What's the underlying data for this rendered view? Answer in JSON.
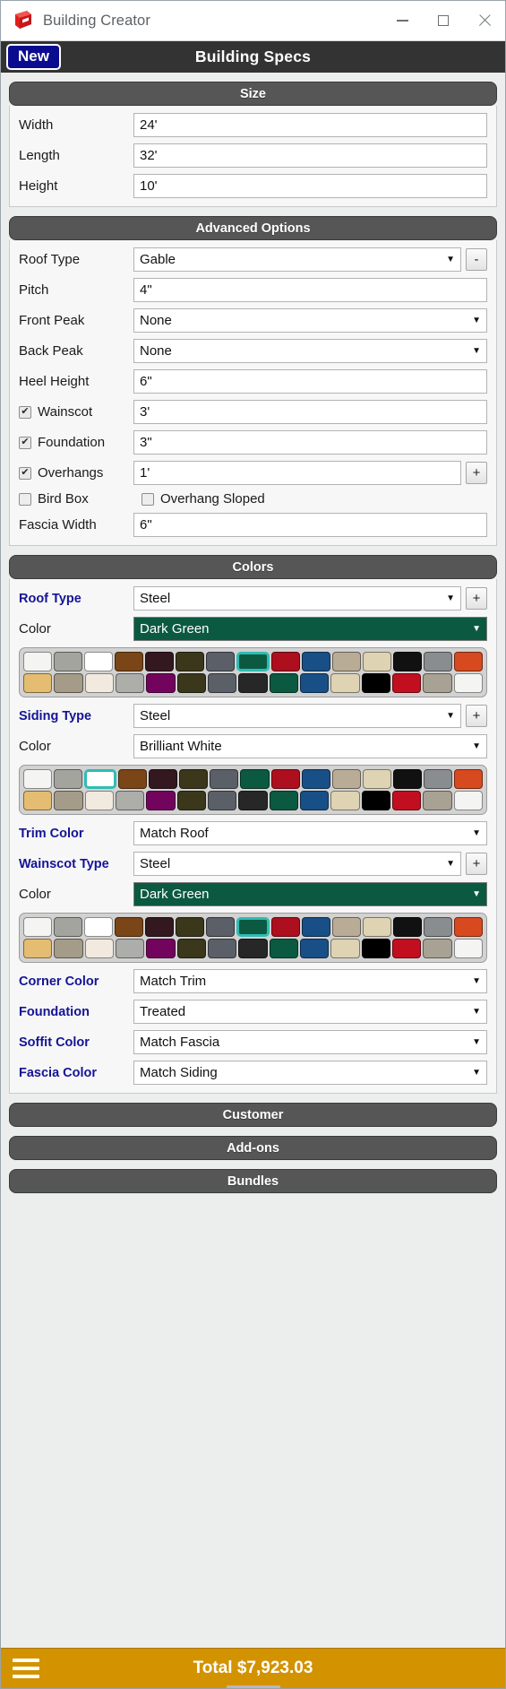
{
  "window": {
    "title": "Building Creator",
    "logo_icon": "sketchup-logo-icon",
    "minimize_icon": "minimize-icon",
    "maximize_icon": "maximize-icon",
    "close_icon": "close-icon"
  },
  "header": {
    "new_label": "New",
    "title": "Building Specs"
  },
  "sections": {
    "size": {
      "title": "Size",
      "fields": [
        {
          "label": "Width",
          "value": "24'"
        },
        {
          "label": "Length",
          "value": "32'"
        },
        {
          "label": "Height",
          "value": "10'"
        }
      ]
    },
    "advanced": {
      "title": "Advanced Options",
      "roof_type": {
        "label": "Roof Type",
        "value": "Gable",
        "button": "-"
      },
      "pitch": {
        "label": "Pitch",
        "value": "4\""
      },
      "front_peak": {
        "label": "Front Peak",
        "value": "None"
      },
      "back_peak": {
        "label": "Back Peak",
        "value": "None"
      },
      "heel_height": {
        "label": "Heel Height",
        "value": "6\""
      },
      "wainscot": {
        "label": "Wainscot",
        "checked": true,
        "value": "3'"
      },
      "foundation": {
        "label": "Foundation",
        "checked": true,
        "value": "3\""
      },
      "overhangs": {
        "label": "Overhangs",
        "checked": true,
        "value": "1'",
        "button": "+"
      },
      "bird_box": {
        "label": "Bird Box",
        "checked": false
      },
      "overhang_sloped": {
        "label": "Overhang Sloped",
        "checked": false
      },
      "fascia_width": {
        "label": "Fascia Width",
        "value": "6\""
      }
    },
    "colors": {
      "title": "Colors",
      "color_label": "Color",
      "roof": {
        "type_label": "Roof Type",
        "type_value": "Steel",
        "add_button": "+",
        "color_value": "Dark Green",
        "color_hex": "#0b5940",
        "selected_index": 7,
        "palette_row1": [
          "#f4f5f2",
          "#a4a49f",
          "#ffffff",
          "#7a4617",
          "#331820",
          "#3a371b",
          "#5b6068",
          "#0b5940",
          "#ad0f1e",
          "#184f86",
          "#b8ac97",
          "#ded3b2",
          "#111111",
          "#8a8d90",
          "#d7491f"
        ],
        "palette_row2": [
          "#e4bd72",
          "#a49c89",
          "#f2eade",
          "#adadaa",
          "#72045e",
          "#3a371b",
          "#5b6068",
          "#272727",
          "#0b5940",
          "#184f86",
          "#ded3b2",
          "#000000",
          "#c20f1f",
          "#a8a294",
          "#f4f5f2"
        ]
      },
      "siding": {
        "type_label": "Siding Type",
        "type_value": "Steel",
        "add_button": "+",
        "color_value": "Brilliant White",
        "color_hex": "#ffffff",
        "selected_index": 2,
        "palette_row1": [
          "#f4f5f2",
          "#a4a49f",
          "#ffffff",
          "#7a4617",
          "#331820",
          "#3a371b",
          "#5b6068",
          "#0b5940",
          "#ad0f1e",
          "#184f86",
          "#b8ac97",
          "#ded3b2",
          "#111111",
          "#8a8d90",
          "#d7491f"
        ],
        "palette_row2": [
          "#e4bd72",
          "#a49c89",
          "#f2eade",
          "#adadaa",
          "#72045e",
          "#3a371b",
          "#5b6068",
          "#272727",
          "#0b5940",
          "#184f86",
          "#ded3b2",
          "#000000",
          "#c20f1f",
          "#a8a294",
          "#f4f5f2"
        ]
      },
      "trim": {
        "label": "Trim Color",
        "value": "Match Roof"
      },
      "wainscot": {
        "type_label": "Wainscot Type",
        "type_value": "Steel",
        "add_button": "+",
        "color_value": "Dark Green",
        "color_hex": "#0b5940",
        "selected_index": 7,
        "palette_row1": [
          "#f4f5f2",
          "#a4a49f",
          "#ffffff",
          "#7a4617",
          "#331820",
          "#3a371b",
          "#5b6068",
          "#0b5940",
          "#ad0f1e",
          "#184f86",
          "#b8ac97",
          "#ded3b2",
          "#111111",
          "#8a8d90",
          "#d7491f"
        ],
        "palette_row2": [
          "#e4bd72",
          "#a49c89",
          "#f2eade",
          "#adadaa",
          "#72045e",
          "#3a371b",
          "#5b6068",
          "#272727",
          "#0b5940",
          "#184f86",
          "#ded3b2",
          "#000000",
          "#c20f1f",
          "#a8a294",
          "#f4f5f2"
        ]
      },
      "corner": {
        "label": "Corner Color",
        "value": "Match Trim"
      },
      "foundation": {
        "label": "Foundation",
        "value": "Treated"
      },
      "soffit": {
        "label": "Soffit Color",
        "value": "Match Fascia"
      },
      "fascia": {
        "label": "Fascia Color",
        "value": "Match Siding"
      }
    },
    "customer": {
      "title": "Customer"
    },
    "addons": {
      "title": "Add-ons"
    },
    "bundles": {
      "title": "Bundles"
    }
  },
  "footer": {
    "menu_icon": "hamburger-menu-icon",
    "total": "Total $7,923.03"
  },
  "glyphs": {
    "caret_down": "▼",
    "check": "✔"
  }
}
